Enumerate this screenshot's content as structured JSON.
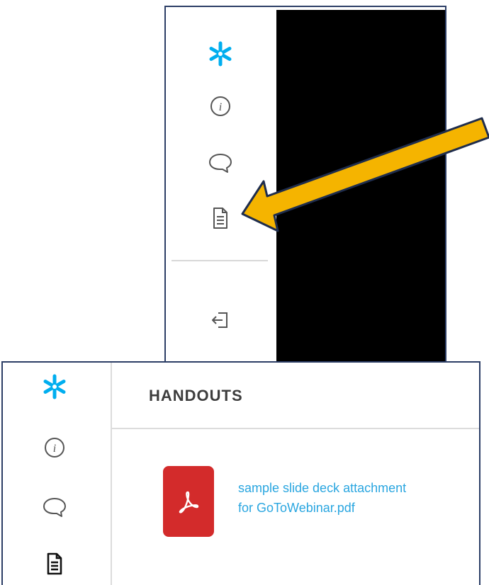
{
  "icons": {
    "logo": "snowflake-logo-icon",
    "info": "info-icon",
    "chat": "chat-bubble-icon",
    "handouts": "document-icon",
    "leave": "exit-icon",
    "pdf": "pdf-icon",
    "pointer": "arrow-pointer-icon"
  },
  "colors": {
    "accent": "#00aeef",
    "link": "#2aa6e0",
    "pdf_tile": "#d32b2b",
    "arrow_fill": "#f5b400",
    "frame": "#2c3e66"
  },
  "handouts": {
    "title": "HANDOUTS",
    "files": [
      {
        "name_line1": "sample slide deck attachment",
        "name_line2": "for GoToWebinar.pdf"
      }
    ]
  }
}
